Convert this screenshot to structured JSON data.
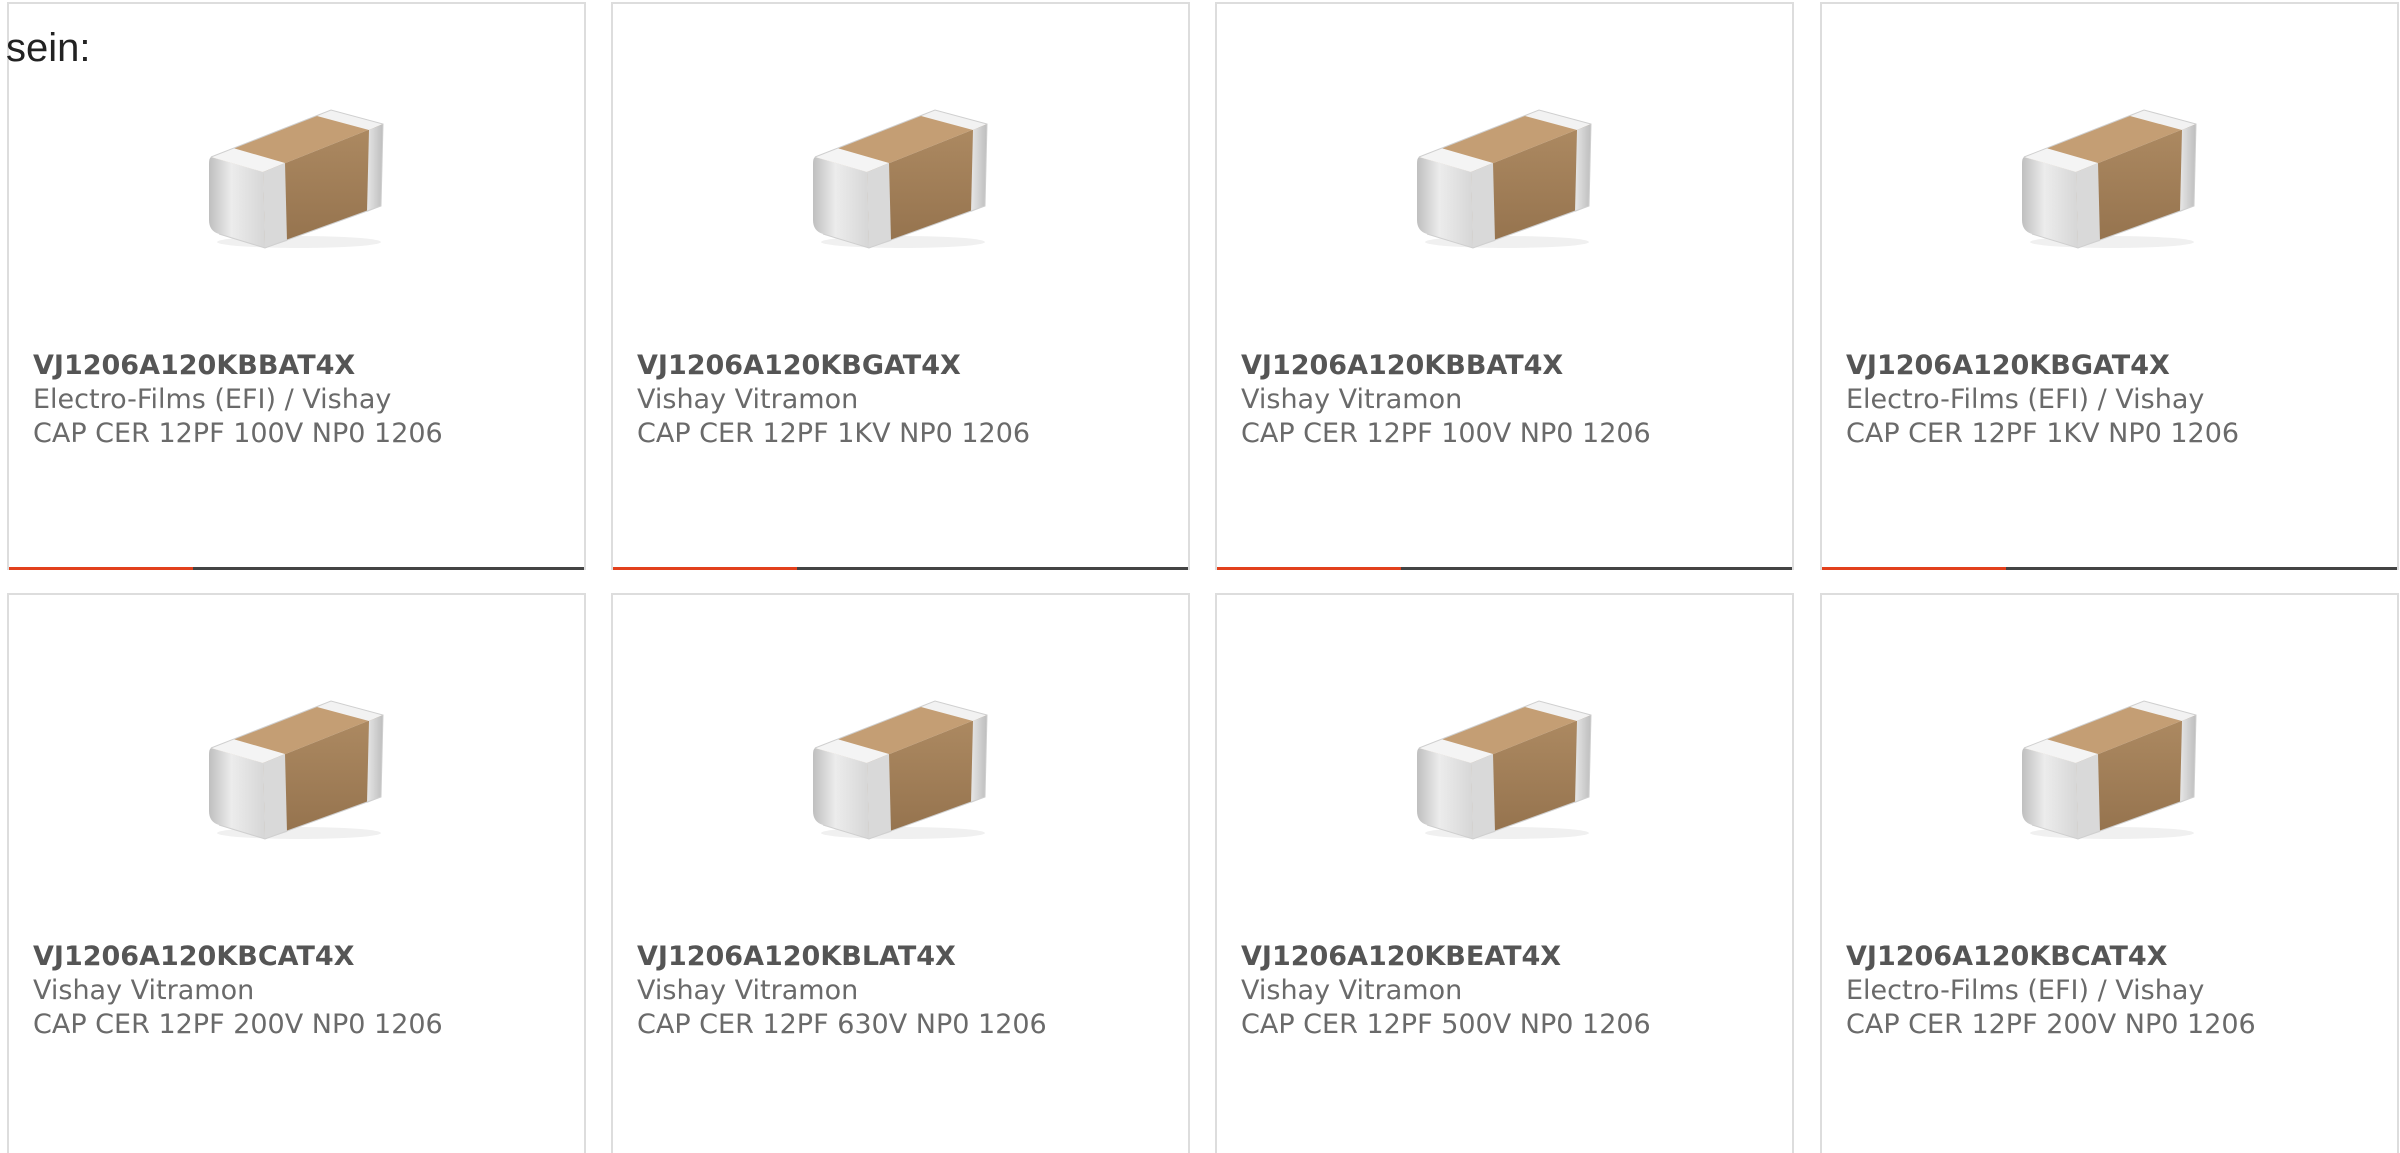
{
  "intro": {
    "text": "sein:"
  },
  "accent_color": "#e2401c",
  "bar_color": "#444444",
  "chip_icon": "ceramic-capacitor-1206-chip",
  "products": [
    {
      "part_number": "VJ1206A120KBBAT4X",
      "manufacturer": "Electro-Films (EFI) / Vishay",
      "description": "CAP CER 12PF 100V NP0 1206",
      "progress": 0.32
    },
    {
      "part_number": "VJ1206A120KBGAT4X",
      "manufacturer": "Vishay Vitramon",
      "description": "CAP CER 12PF 1KV NP0 1206",
      "progress": 0.32
    },
    {
      "part_number": "VJ1206A120KBBAT4X",
      "manufacturer": "Vishay Vitramon",
      "description": "CAP CER 12PF 100V NP0 1206",
      "progress": 0.32
    },
    {
      "part_number": "VJ1206A120KBGAT4X",
      "manufacturer": "Electro-Films (EFI) / Vishay",
      "description": "CAP CER 12PF 1KV NP0 1206",
      "progress": 0.32
    },
    {
      "part_number": "VJ1206A120KBCAT4X",
      "manufacturer": "Vishay Vitramon",
      "description": "CAP CER 12PF 200V NP0 1206"
    },
    {
      "part_number": "VJ1206A120KBLAT4X",
      "manufacturer": "Vishay Vitramon",
      "description": "CAP CER 12PF 630V NP0 1206"
    },
    {
      "part_number": "VJ1206A120KBEAT4X",
      "manufacturer": "Vishay Vitramon",
      "description": "CAP CER 12PF 500V NP0 1206"
    },
    {
      "part_number": "VJ1206A120KBCAT4X",
      "manufacturer": "Electro-Films (EFI) / Vishay",
      "description": "CAP CER 12PF 200V NP0 1206"
    }
  ]
}
